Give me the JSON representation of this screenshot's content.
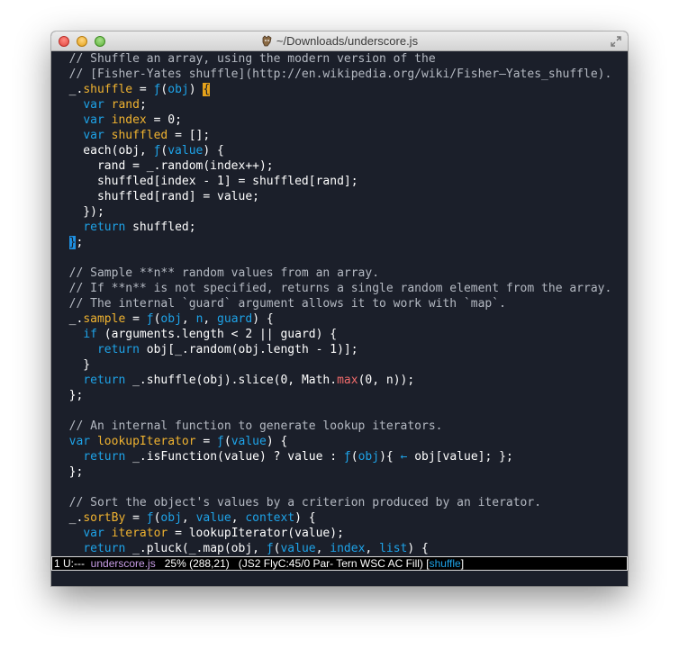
{
  "window": {
    "title": "~/Downloads/underscore.js"
  },
  "colors": {
    "background": "#1b1f2a",
    "comment": "#b4b9c2",
    "keyword": "#1ea3e8",
    "identifier": "#f0b330",
    "builtin": "#f06b6b",
    "cursor": "#e6a21a",
    "modeline_buffer": "#c99ee8"
  },
  "code_lines": [
    [
      {
        "t": "  // Shuffle an array, using the modern version of the",
        "c": "comment"
      }
    ],
    [
      {
        "t": "  // [Fisher-Yates shuffle](http://en.wikipedia.org/wiki/Fisher–Yates_shuffle).",
        "c": "comment"
      }
    ],
    [
      {
        "t": "  _.",
        "c": "plain"
      },
      {
        "t": "shuffle",
        "c": "fn"
      },
      {
        "t": " = ",
        "c": "plain"
      },
      {
        "t": "ƒ",
        "c": "kw"
      },
      {
        "t": "(",
        "c": "plain"
      },
      {
        "t": "obj",
        "c": "param"
      },
      {
        "t": ") ",
        "c": "plain"
      },
      {
        "t": "{",
        "c": "cursor"
      }
    ],
    [
      {
        "t": "    ",
        "c": "plain"
      },
      {
        "t": "var",
        "c": "kw"
      },
      {
        "t": " ",
        "c": "plain"
      },
      {
        "t": "rand",
        "c": "var"
      },
      {
        "t": ";",
        "c": "plain"
      }
    ],
    [
      {
        "t": "    ",
        "c": "plain"
      },
      {
        "t": "var",
        "c": "kw"
      },
      {
        "t": " ",
        "c": "plain"
      },
      {
        "t": "index",
        "c": "var"
      },
      {
        "t": " = 0;",
        "c": "plain"
      }
    ],
    [
      {
        "t": "    ",
        "c": "plain"
      },
      {
        "t": "var",
        "c": "kw"
      },
      {
        "t": " ",
        "c": "plain"
      },
      {
        "t": "shuffled",
        "c": "var"
      },
      {
        "t": " = [];",
        "c": "plain"
      }
    ],
    [
      {
        "t": "    each(obj, ",
        "c": "plain"
      },
      {
        "t": "ƒ",
        "c": "kw"
      },
      {
        "t": "(",
        "c": "plain"
      },
      {
        "t": "value",
        "c": "param"
      },
      {
        "t": ") {",
        "c": "plain"
      }
    ],
    [
      {
        "t": "      rand = _.random(index++);",
        "c": "plain"
      }
    ],
    [
      {
        "t": "      shuffled[index - 1] = shuffled[rand];",
        "c": "plain"
      }
    ],
    [
      {
        "t": "      shuffled[rand] = value;",
        "c": "plain"
      }
    ],
    [
      {
        "t": "    });",
        "c": "plain"
      }
    ],
    [
      {
        "t": "    ",
        "c": "plain"
      },
      {
        "t": "return",
        "c": "kw"
      },
      {
        "t": " shuffled;",
        "c": "plain"
      }
    ],
    [
      {
        "t": "  ",
        "c": "plain"
      },
      {
        "t": "}",
        "c": "match"
      },
      {
        "t": ";",
        "c": "plain"
      }
    ],
    [
      {
        "t": "",
        "c": "plain"
      }
    ],
    [
      {
        "t": "  // Sample **n** random values from an array.",
        "c": "comment"
      }
    ],
    [
      {
        "t": "  // If **n** is not specified, returns a single random element from the array.",
        "c": "comment"
      }
    ],
    [
      {
        "t": "  // The internal `guard` argument allows it to work with `map`.",
        "c": "comment"
      }
    ],
    [
      {
        "t": "  _.",
        "c": "plain"
      },
      {
        "t": "sample",
        "c": "fn"
      },
      {
        "t": " = ",
        "c": "plain"
      },
      {
        "t": "ƒ",
        "c": "kw"
      },
      {
        "t": "(",
        "c": "plain"
      },
      {
        "t": "obj",
        "c": "param"
      },
      {
        "t": ", ",
        "c": "plain"
      },
      {
        "t": "n",
        "c": "param"
      },
      {
        "t": ", ",
        "c": "plain"
      },
      {
        "t": "guard",
        "c": "param"
      },
      {
        "t": ") {",
        "c": "plain"
      }
    ],
    [
      {
        "t": "    ",
        "c": "plain"
      },
      {
        "t": "if",
        "c": "kw"
      },
      {
        "t": " (arguments.length < 2 || guard) {",
        "c": "plain"
      }
    ],
    [
      {
        "t": "      ",
        "c": "plain"
      },
      {
        "t": "return",
        "c": "kw"
      },
      {
        "t": " obj[_.random(obj.length - 1)];",
        "c": "plain"
      }
    ],
    [
      {
        "t": "    }",
        "c": "plain"
      }
    ],
    [
      {
        "t": "    ",
        "c": "plain"
      },
      {
        "t": "return",
        "c": "kw"
      },
      {
        "t": " _.shuffle(obj).slice(0, Math.",
        "c": "plain"
      },
      {
        "t": "max",
        "c": "builtin"
      },
      {
        "t": "(0, n));",
        "c": "plain"
      }
    ],
    [
      {
        "t": "  };",
        "c": "plain"
      }
    ],
    [
      {
        "t": "",
        "c": "plain"
      }
    ],
    [
      {
        "t": "  // An internal function to generate lookup iterators.",
        "c": "comment"
      }
    ],
    [
      {
        "t": "  ",
        "c": "plain"
      },
      {
        "t": "var",
        "c": "kw"
      },
      {
        "t": " ",
        "c": "plain"
      },
      {
        "t": "lookupIterator",
        "c": "fn"
      },
      {
        "t": " = ",
        "c": "plain"
      },
      {
        "t": "ƒ",
        "c": "kw"
      },
      {
        "t": "(",
        "c": "plain"
      },
      {
        "t": "value",
        "c": "param"
      },
      {
        "t": ") {",
        "c": "plain"
      }
    ],
    [
      {
        "t": "    ",
        "c": "plain"
      },
      {
        "t": "return",
        "c": "kw"
      },
      {
        "t": " _.isFunction(value) ? value : ",
        "c": "plain"
      },
      {
        "t": "ƒ",
        "c": "kw"
      },
      {
        "t": "(",
        "c": "plain"
      },
      {
        "t": "obj",
        "c": "param"
      },
      {
        "t": "){ ",
        "c": "plain"
      },
      {
        "t": "←",
        "c": "kw"
      },
      {
        "t": " obj[value]; };",
        "c": "plain"
      }
    ],
    [
      {
        "t": "  };",
        "c": "plain"
      }
    ],
    [
      {
        "t": "",
        "c": "plain"
      }
    ],
    [
      {
        "t": "  // Sort the object's values by a criterion produced by an iterator.",
        "c": "comment"
      }
    ],
    [
      {
        "t": "  _.",
        "c": "plain"
      },
      {
        "t": "sortBy",
        "c": "fn"
      },
      {
        "t": " = ",
        "c": "plain"
      },
      {
        "t": "ƒ",
        "c": "kw"
      },
      {
        "t": "(",
        "c": "plain"
      },
      {
        "t": "obj",
        "c": "param"
      },
      {
        "t": ", ",
        "c": "plain"
      },
      {
        "t": "value",
        "c": "param"
      },
      {
        "t": ", ",
        "c": "plain"
      },
      {
        "t": "context",
        "c": "param"
      },
      {
        "t": ") {",
        "c": "plain"
      }
    ],
    [
      {
        "t": "    ",
        "c": "plain"
      },
      {
        "t": "var",
        "c": "kw"
      },
      {
        "t": " ",
        "c": "plain"
      },
      {
        "t": "iterator",
        "c": "var"
      },
      {
        "t": " = lookupIterator(value);",
        "c": "plain"
      }
    ],
    [
      {
        "t": "    ",
        "c": "plain"
      },
      {
        "t": "return",
        "c": "kw"
      },
      {
        "t": " _.pluck(_.map(obj, ",
        "c": "plain"
      },
      {
        "t": "ƒ",
        "c": "kw"
      },
      {
        "t": "(",
        "c": "plain"
      },
      {
        "t": "value",
        "c": "param"
      },
      {
        "t": ", ",
        "c": "plain"
      },
      {
        "t": "index",
        "c": "param"
      },
      {
        "t": ", ",
        "c": "plain"
      },
      {
        "t": "list",
        "c": "param"
      },
      {
        "t": ") {",
        "c": "plain"
      }
    ]
  ],
  "modeline": {
    "prefix": "1 U:---  ",
    "buffer": "underscore.js",
    "position": "   25% (288,21)   (JS2 FlyC:45/0 Par- Tern WSC AC Fill) [",
    "function": "shuffle",
    "suffix": "]"
  }
}
